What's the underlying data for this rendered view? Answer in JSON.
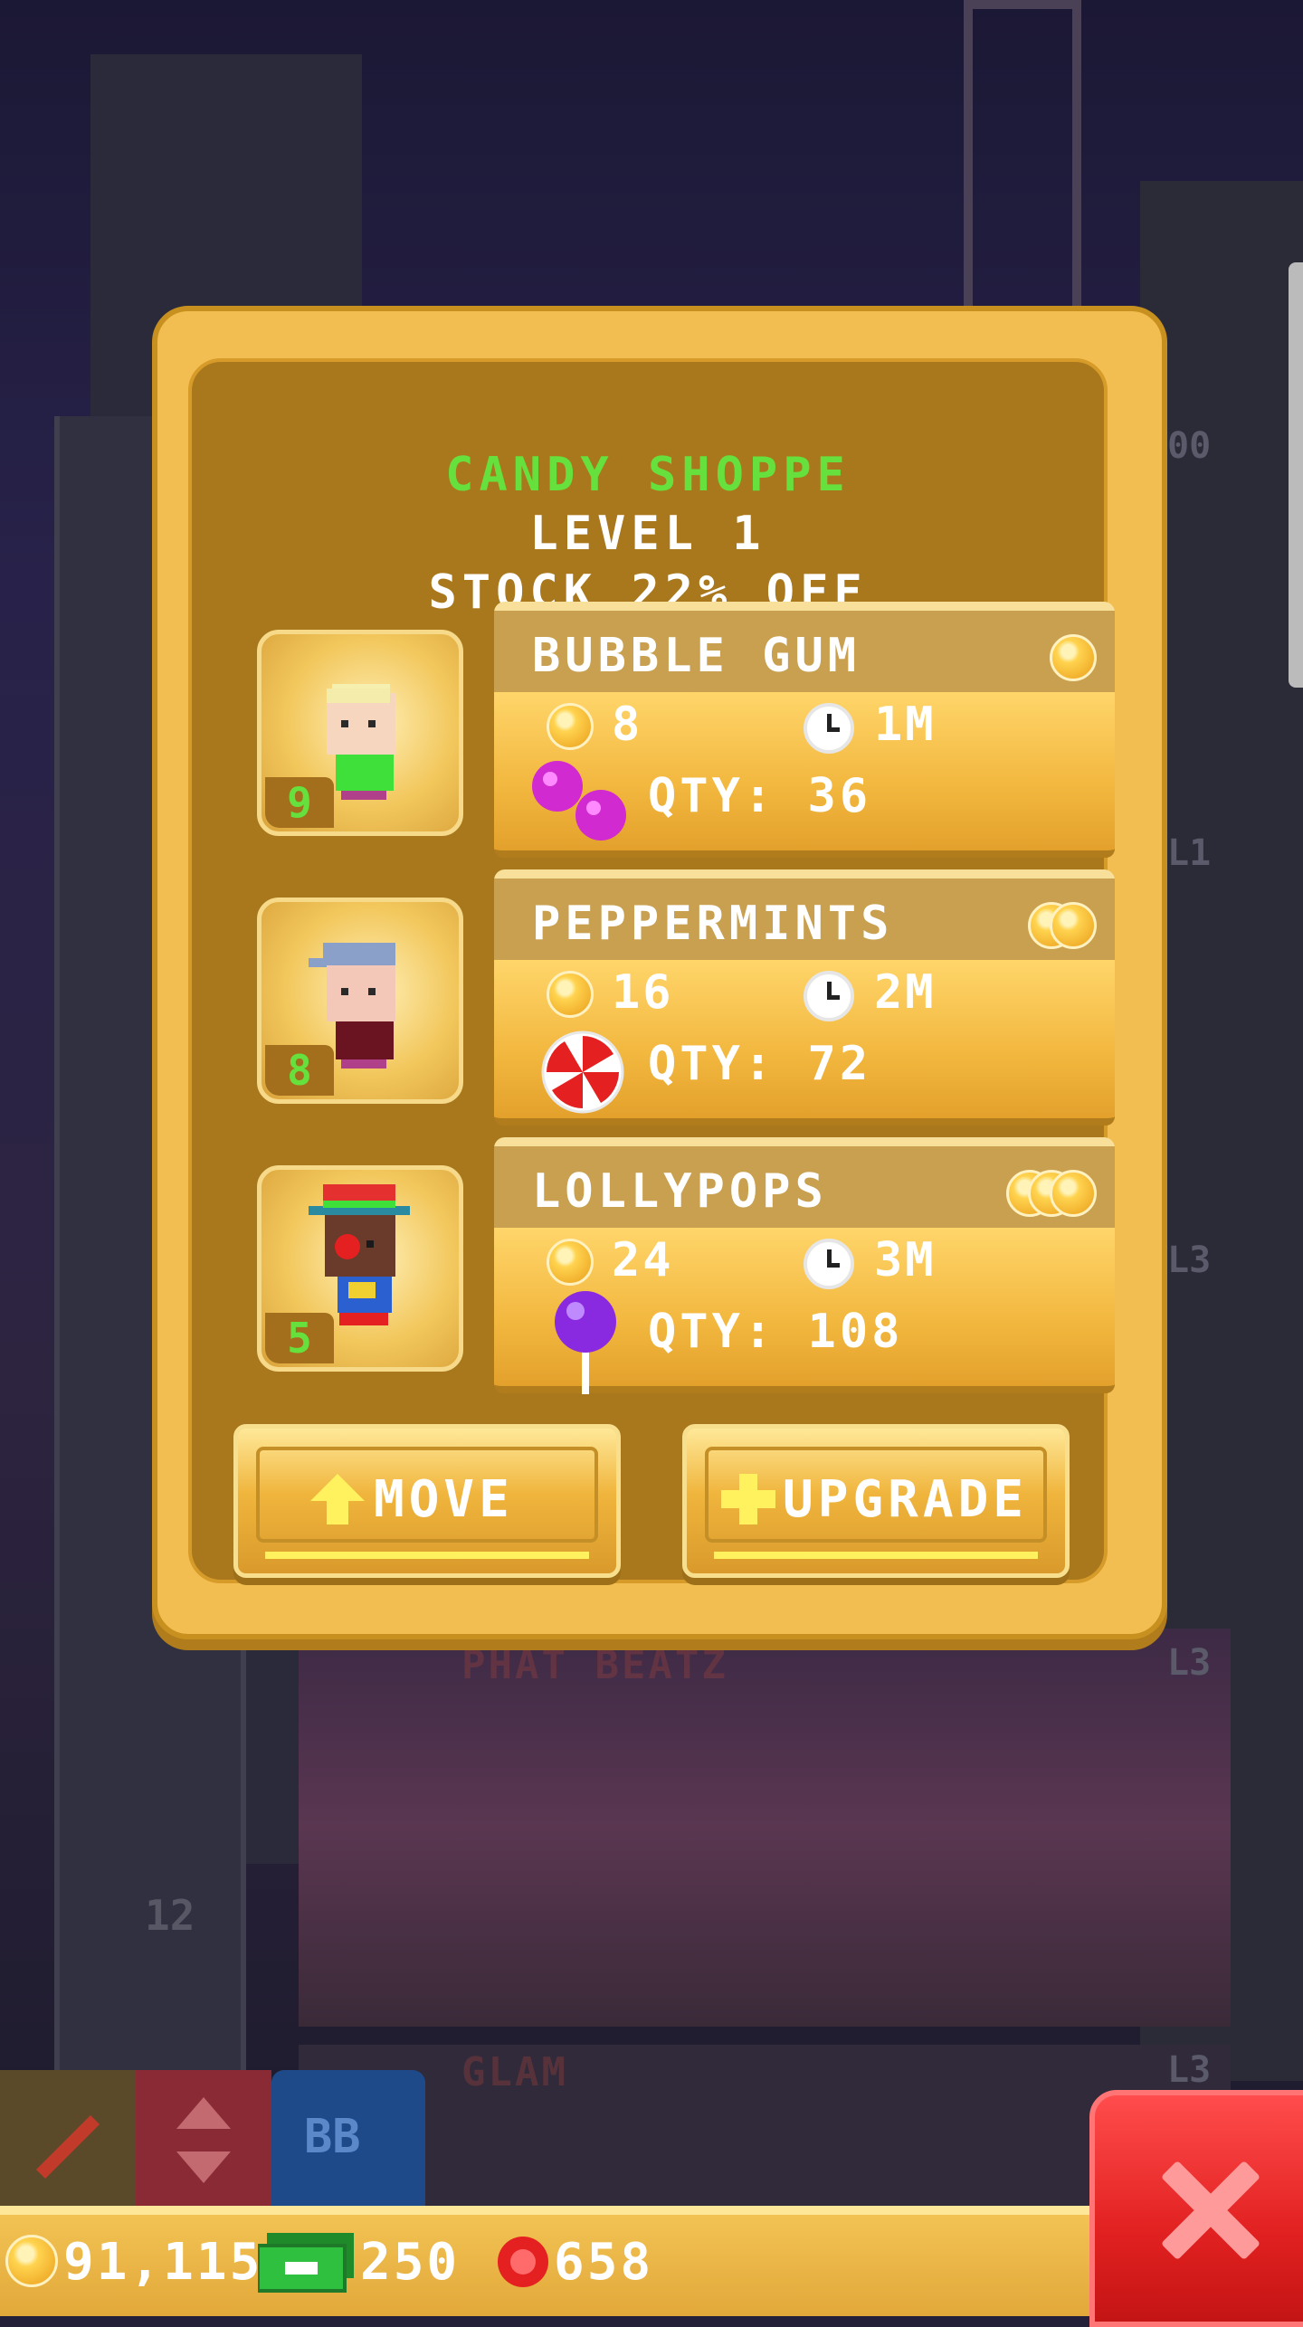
{
  "shop": {
    "title": "CANDY SHOPPE",
    "level": "LEVEL 1",
    "stock": "STOCK 22% OFF"
  },
  "workers": [
    {
      "level": "9",
      "name": "blonde-worker-avatar"
    },
    {
      "level": "8",
      "name": "cap-worker-avatar"
    },
    {
      "level": "5",
      "name": "clown-worker-avatar"
    }
  ],
  "items": [
    {
      "name": "BUBBLE GUM",
      "price": "8",
      "time": "1M",
      "qty": "QTY: 36",
      "tier_coins": 1,
      "icon": "bubble-gum-icon"
    },
    {
      "name": "PEPPERMINTS",
      "price": "16",
      "time": "2M",
      "qty": "QTY: 72",
      "tier_coins": 2,
      "icon": "peppermint-icon"
    },
    {
      "name": "LOLLYPOPS",
      "price": "24",
      "time": "3M",
      "qty": "QTY: 108",
      "tier_coins": 3,
      "icon": "lollipop-icon"
    }
  ],
  "buttons": {
    "move": "MOVE",
    "upgrade": "UPGRADE"
  },
  "background": {
    "floor_12": "12",
    "floor_phat_beatz": "PHAT BEATZ",
    "floor_glam": "GLAM",
    "tag_l1": "L1",
    "tag_l3a": "L3",
    "tag_l3b": "L3",
    "tag_l3c": "L3",
    "tag_00": "00",
    "tool_bb": "BB"
  },
  "currency": {
    "coins": "91,115",
    "bux": "250",
    "tokens": "658"
  },
  "colors": {
    "shop_title": "#66e03c",
    "panel_gold": "#f2be52",
    "panel_inner": "#a9781d",
    "close_red": "#e22121"
  }
}
